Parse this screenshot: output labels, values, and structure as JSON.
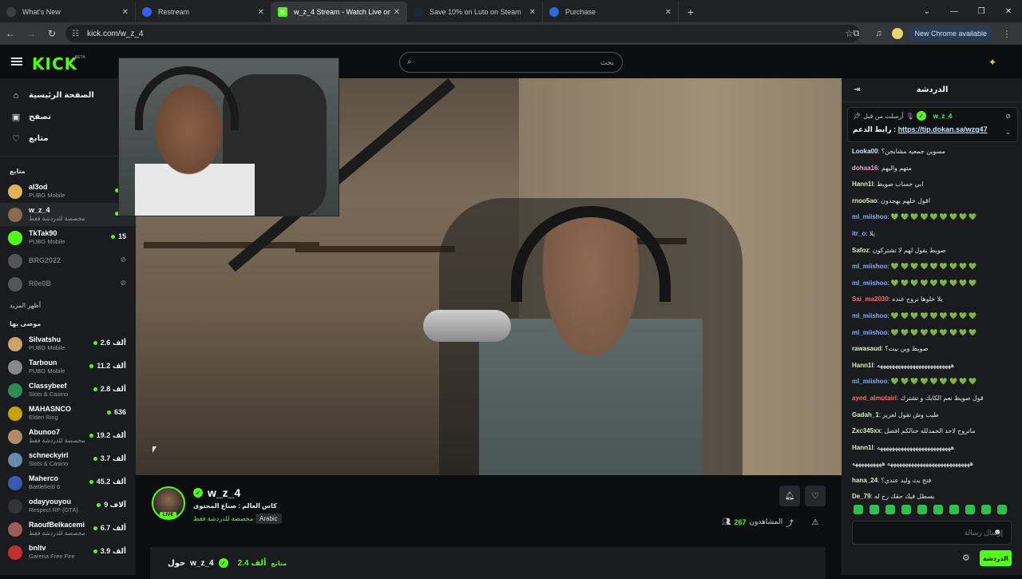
{
  "browser": {
    "tabs": [
      {
        "title": "What's New",
        "favicon_color": "#3c4043",
        "icon": "globe-icon",
        "active": false
      },
      {
        "title": "Restream",
        "favicon_color": "#3b5bfd",
        "icon": "restream-icon",
        "active": false
      },
      {
        "title": "w_z_4 Stream - Watch Live on Kick",
        "favicon_color": "#53fc18",
        "icon": "kick-icon",
        "active": true
      },
      {
        "title": "Save 10% on Luto on Steam",
        "favicon_color": "#1b2838",
        "icon": "steam-icon",
        "active": false
      },
      {
        "title": "Purchase",
        "favicon_color": "#2a6bd8",
        "icon": "purchase-icon",
        "active": false
      }
    ],
    "url": "kick.com/w_z_4",
    "new_chrome": "New Chrome available"
  },
  "header": {
    "logo": "KICK",
    "beta": "BETA",
    "search_placeholder": "بحث"
  },
  "sidebar": {
    "nav": [
      {
        "label": "الصفحة الرئيسية",
        "icon": "home-icon"
      },
      {
        "label": "تصفح",
        "icon": "browse-icon"
      },
      {
        "label": "متابع",
        "icon": "heart-icon"
      }
    ],
    "following_title": "متابع",
    "following": [
      {
        "name": "al3od",
        "sub": "PUBG Mobile",
        "viewers": "6",
        "color": "#e0b25a",
        "active": false,
        "offline": false
      },
      {
        "name": "w_z_4",
        "sub": "مخصصة للدردشة فقط",
        "viewers": "2",
        "color": "#8a6a50",
        "active": true,
        "offline": false
      },
      {
        "name": "TkTak90",
        "sub": "PUBG Mobile",
        "viewers": "15",
        "color": "#53fc18",
        "active": false,
        "offline": false
      },
      {
        "name": "BRG2022",
        "sub": "",
        "viewers": "",
        "color": "#555",
        "active": false,
        "offline": true
      },
      {
        "name": "R0e0B",
        "sub": "",
        "viewers": "",
        "color": "#555",
        "active": false,
        "offline": true
      }
    ],
    "show_more": "أظهر المزيد",
    "recommended_title": "موصى بها",
    "recommended": [
      {
        "name": "Silvatshu",
        "sub": "PUBG Mobile",
        "viewers": "2.6 ألف",
        "color": "#c9a36b"
      },
      {
        "name": "Tarboun",
        "sub": "PUBG Mobile",
        "viewers": "11.2 ألف",
        "color": "#888"
      },
      {
        "name": "Classybeef",
        "sub": "Slots & Casino",
        "viewers": "2.8 ألف",
        "color": "#2e8b57"
      },
      {
        "name": "MAHASNCO",
        "sub": "Elden Ring",
        "viewers": "636",
        "color": "#c8a000"
      },
      {
        "name": "Abunoo7",
        "sub": "مخصصة للدردشة فقط",
        "viewers": "19.2 ألف",
        "color": "#b08a6a"
      },
      {
        "name": "schneckyirl",
        "sub": "Slots & Casino",
        "viewers": "3.7 ألف",
        "color": "#6a8ab0"
      },
      {
        "name": "Maherco",
        "sub": "Battlefield 6",
        "viewers": "45.2 ألف",
        "color": "#3a5ab0"
      },
      {
        "name": "odayyouyou",
        "sub": "Respect RP (GTA)",
        "viewers": "9 آلاف",
        "color": "#333"
      },
      {
        "name": "RaoufBelkacemi",
        "sub": "مخصصة للدردشة فقط",
        "viewers": "6.7 ألف",
        "color": "#a05a5a"
      },
      {
        "name": "bnltv",
        "sub": "Garena Free Fire",
        "viewers": "3.9 ألف",
        "color": "#c03030"
      }
    ]
  },
  "channel": {
    "name": "w_z_4",
    "live": "LIVE",
    "title": "كاس العالم : صناع المحتوى",
    "category": "مخصصة للدردشة فقط",
    "tag": "Arabic",
    "viewers_count": "267",
    "viewers_label": "المشاهدون",
    "about_prefix": "حول",
    "about_name": "w_z_4",
    "followers": "2.4 ألف",
    "followers_label": "متابع"
  },
  "chat": {
    "title": "الدردشة",
    "pinned_user": "w_z_4",
    "pinned_sent": "أرسلت من قبل",
    "pinned_text": "رابط الدعم :",
    "pinned_link": "https://tip.dokan.sa/wzg47",
    "messages": [
      {
        "user": "Looka00",
        "text": "مسوين جمعيه مشابجن؟",
        "color": "#cfe8ff"
      },
      {
        "user": "dohaa16",
        "text": "متهم واليهم",
        "color": "#f0a0d0"
      },
      {
        "user": "Hann1l",
        "text": "ابي حساب صويط",
        "color": "#d8f0c0"
      },
      {
        "user": "rnoo5ao",
        "text": "اقول خلهم يهجدون",
        "color": "#d8f0c0"
      },
      {
        "user": "ml_miishoo",
        "text": "💚 💚 💚 💚 💚 💚 💚 💚 💚",
        "color": "#80b0ff"
      },
      {
        "user": "itr_o",
        "text": "يلا",
        "color": "#80b0ff"
      },
      {
        "user": "Safoz",
        "text": "صويط يقول لهم لا تشتركون",
        "color": "#d8f0c0"
      },
      {
        "user": "ml_miishoo",
        "text": "💚 💚 💚 💚 💚 💚 💚 💚 💚",
        "color": "#80b0ff"
      },
      {
        "user": "ml_miishoo",
        "text": "💚 💚 💚 💚 💚 💚 💚 💚 💚",
        "color": "#80b0ff"
      },
      {
        "user": "Sai_ma2030",
        "text": "يلا خلوها نروح عنده",
        "color": "#ff6a6a"
      },
      {
        "user": "ml_miishoo",
        "text": "💚 💚 💚 💚 💚 💚 💚 💚 💚",
        "color": "#80b0ff"
      },
      {
        "user": "ml_miishoo",
        "text": "💚 💚 💚 💚 💚 💚 💚 💚 💚",
        "color": "#80b0ff"
      },
      {
        "user": "rawasaud",
        "text": "صويط وين بيت؟",
        "color": "#d8f0c0"
      },
      {
        "user": "Hann1l",
        "text": "هههههههههههههههههههههههههه",
        "color": "#d8f0c0"
      },
      {
        "user": "ml_miishoo",
        "text": "💚 💚 💚 💚 💚 💚 💚 💚 💚",
        "color": "#80b0ff"
      },
      {
        "user": "ayed_almutairi",
        "text": "قول صويط نعم الكابك و تشترك",
        "color": "#ff6a6a"
      },
      {
        "user": "Gadah_1",
        "text": "طيب وش تقول لعزيز",
        "color": "#d8f0c0"
      },
      {
        "user": "Zxc345xx",
        "text": "ماتروح لاحد الحمدلله حنالكم افضل",
        "color": "#d8f0c0"
      },
      {
        "user": "Hann1l",
        "text": "هههههههههههههههههههههههههه",
        "color": "#d8f0c0"
      },
      {
        "user": "",
        "text": "ههههههههههههههههههههههههههههه ههههههههههه",
        "color": "#d8f0c0"
      },
      {
        "user": "hana_24",
        "text": "فتح بث وليد عندي؟",
        "color": "#d8f0c0"
      },
      {
        "user": "De_79",
        "text": "يسطل فيك حقك رح له",
        "color": "#d8f0c0"
      }
    ],
    "input_placeholder": "إرسال رسالة",
    "send_label": "الدردشة"
  }
}
